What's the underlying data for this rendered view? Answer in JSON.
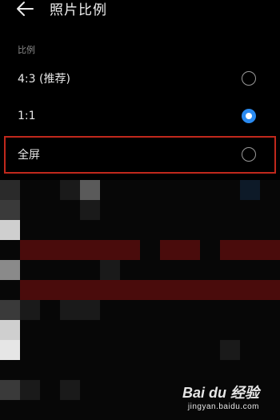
{
  "header": {
    "title": "照片比例"
  },
  "section": {
    "label": "比例"
  },
  "options": [
    {
      "label": "4:3 (推荐)",
      "selected": false
    },
    {
      "label": "1:1",
      "selected": true
    },
    {
      "label": "全屏",
      "selected": false,
      "highlighted": true
    }
  ],
  "colors": {
    "accent": "#2a8af0",
    "highlight_border": "#c0281c",
    "background": "#000000"
  },
  "watermark": {
    "logo": "Bai du 经验",
    "url": "jingyan.baidu.com"
  }
}
